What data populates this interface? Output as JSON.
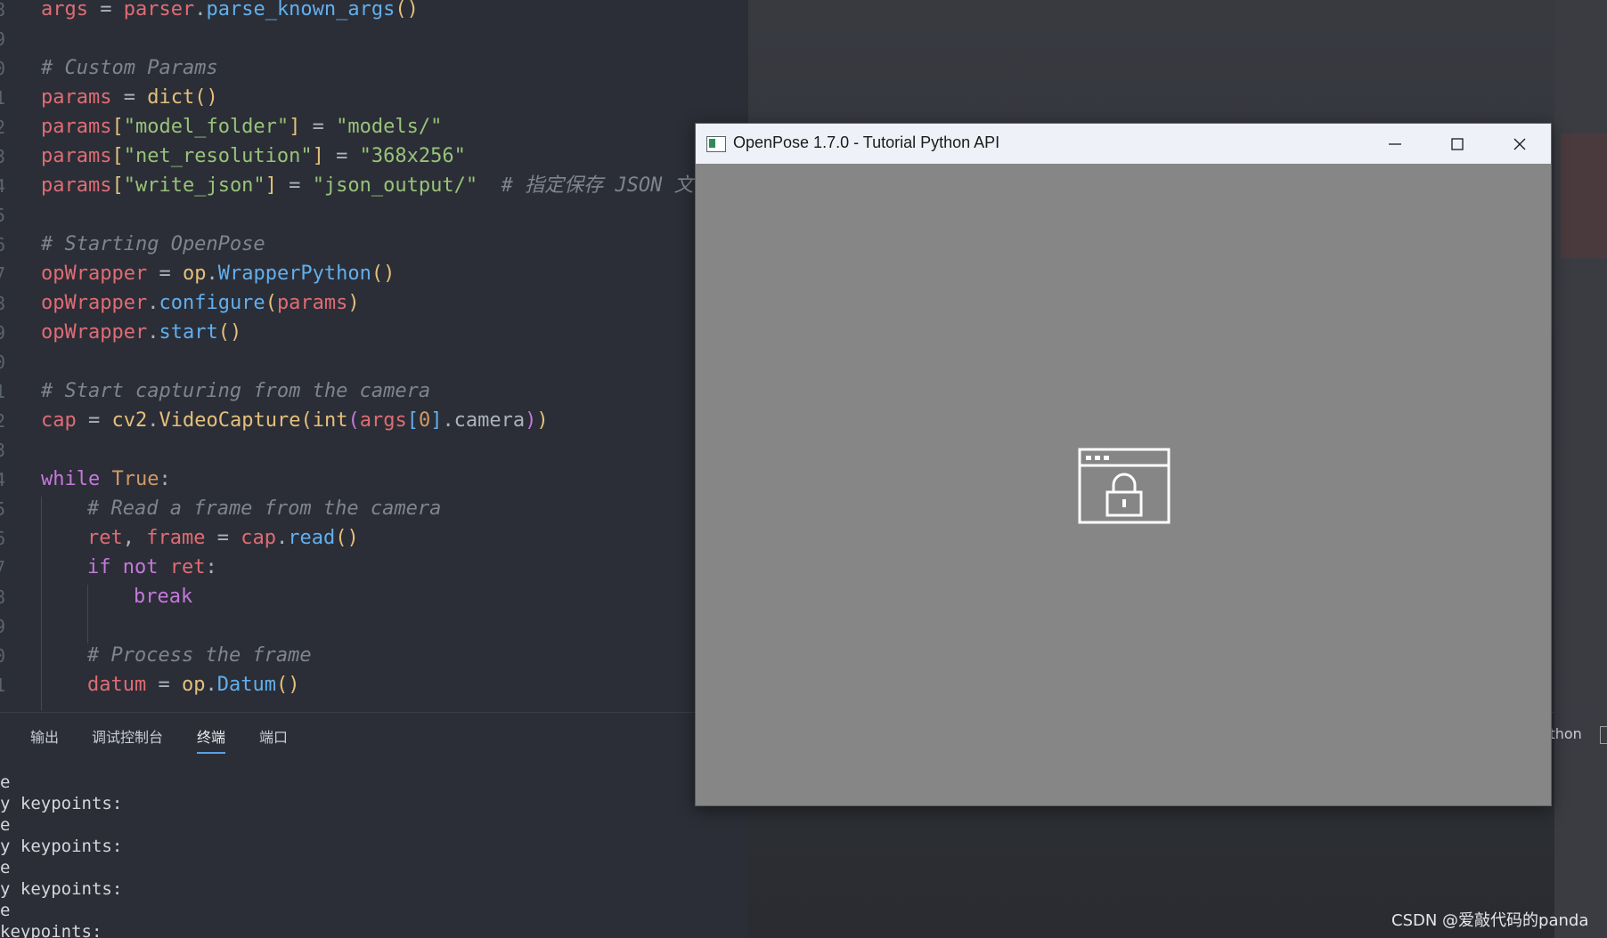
{
  "editor": {
    "lines": [
      {
        "n": "8",
        "parts": [
          [
            "var",
            "args"
          ],
          [
            "pun",
            " = "
          ],
          [
            "var",
            "parser"
          ],
          [
            "pun",
            "."
          ],
          [
            "fn",
            "parse_known_args"
          ],
          [
            "br1",
            "()"
          ]
        ]
      },
      {
        "n": "9",
        "parts": []
      },
      {
        "n": "0",
        "parts": [
          [
            "cmt",
            "# Custom Params"
          ]
        ]
      },
      {
        "n": "1",
        "parts": [
          [
            "var",
            "params"
          ],
          [
            "pun",
            " = "
          ],
          [
            "cls",
            "dict"
          ],
          [
            "br1",
            "()"
          ]
        ]
      },
      {
        "n": "2",
        "parts": [
          [
            "var",
            "params"
          ],
          [
            "br1",
            "["
          ],
          [
            "str",
            "\"model_folder\""
          ],
          [
            "br1",
            "]"
          ],
          [
            "pun",
            " = "
          ],
          [
            "str",
            "\"models/\""
          ]
        ]
      },
      {
        "n": "3",
        "parts": [
          [
            "var",
            "params"
          ],
          [
            "br1",
            "["
          ],
          [
            "str",
            "\"net_resolution\""
          ],
          [
            "br1",
            "]"
          ],
          [
            "pun",
            " = "
          ],
          [
            "str",
            "\"368x256\""
          ]
        ]
      },
      {
        "n": "4",
        "parts": [
          [
            "var",
            "params"
          ],
          [
            "br1",
            "["
          ],
          [
            "str",
            "\"write_json\""
          ],
          [
            "br1",
            "]"
          ],
          [
            "pun",
            " = "
          ],
          [
            "str",
            "\"json_output/\""
          ],
          [
            "pun",
            "  "
          ],
          [
            "cmt",
            "# 指定保存 JSON 文"
          ]
        ]
      },
      {
        "n": "5",
        "parts": []
      },
      {
        "n": "6",
        "parts": [
          [
            "cmt",
            "# Starting OpenPose"
          ]
        ]
      },
      {
        "n": "7",
        "parts": [
          [
            "var",
            "opWrapper"
          ],
          [
            "pun",
            " = "
          ],
          [
            "cls",
            "op"
          ],
          [
            "pun",
            "."
          ],
          [
            "fn",
            "WrapperPython"
          ],
          [
            "br1",
            "()"
          ]
        ]
      },
      {
        "n": "8",
        "parts": [
          [
            "var",
            "opWrapper"
          ],
          [
            "pun",
            "."
          ],
          [
            "fn",
            "configure"
          ],
          [
            "br1",
            "("
          ],
          [
            "var",
            "params"
          ],
          [
            "br1",
            ")"
          ]
        ]
      },
      {
        "n": "9",
        "parts": [
          [
            "var",
            "opWrapper"
          ],
          [
            "pun",
            "."
          ],
          [
            "fn",
            "start"
          ],
          [
            "br1",
            "()"
          ]
        ]
      },
      {
        "n": "0",
        "parts": []
      },
      {
        "n": "1",
        "parts": [
          [
            "cmt",
            "# Start capturing from the camera"
          ]
        ]
      },
      {
        "n": "2",
        "parts": [
          [
            "var",
            "cap"
          ],
          [
            "pun",
            " = "
          ],
          [
            "cls",
            "cv2"
          ],
          [
            "pun",
            "."
          ],
          [
            "cls",
            "VideoCapture"
          ],
          [
            "br1",
            "("
          ],
          [
            "cls",
            "int"
          ],
          [
            "br2",
            "("
          ],
          [
            "var",
            "args"
          ],
          [
            "br3",
            "["
          ],
          [
            "num",
            "0"
          ],
          [
            "br3",
            "]"
          ],
          [
            "pun",
            ".camera"
          ],
          [
            "br2",
            ")"
          ],
          [
            "br1",
            ")"
          ]
        ]
      },
      {
        "n": "3",
        "parts": []
      },
      {
        "n": "4",
        "parts": [
          [
            "kw",
            "while"
          ],
          [
            "pun",
            " "
          ],
          [
            "num",
            "True"
          ],
          [
            "pun",
            ":"
          ]
        ]
      },
      {
        "n": "5",
        "indent": 1,
        "parts": [
          [
            "cmt",
            "# Read a frame from the camera"
          ]
        ]
      },
      {
        "n": "6",
        "indent": 1,
        "parts": [
          [
            "var",
            "ret"
          ],
          [
            "pun",
            ", "
          ],
          [
            "var",
            "frame"
          ],
          [
            "pun",
            " = "
          ],
          [
            "var",
            "cap"
          ],
          [
            "pun",
            "."
          ],
          [
            "fn",
            "read"
          ],
          [
            "br1",
            "()"
          ]
        ]
      },
      {
        "n": "7",
        "indent": 1,
        "parts": [
          [
            "kw",
            "if"
          ],
          [
            "pun",
            " "
          ],
          [
            "kw",
            "not"
          ],
          [
            "pun",
            " "
          ],
          [
            "var",
            "ret"
          ],
          [
            "pun",
            ":"
          ]
        ]
      },
      {
        "n": "8",
        "indent": 2,
        "parts": [
          [
            "kw",
            "break"
          ]
        ]
      },
      {
        "n": "9",
        "parts": []
      },
      {
        "n": "0",
        "indent": 1,
        "parts": [
          [
            "cmt",
            "# Process the frame"
          ]
        ]
      },
      {
        "n": "1",
        "indent": 1,
        "parts": [
          [
            "var",
            "datum"
          ],
          [
            "pun",
            " = "
          ],
          [
            "cls",
            "op"
          ],
          [
            "pun",
            "."
          ],
          [
            "fn",
            "Datum"
          ],
          [
            "br1",
            "()"
          ]
        ]
      }
    ]
  },
  "panel": {
    "tabs": [
      "输出",
      "调试控制台",
      "终端",
      "端口"
    ],
    "active_tab": "终端",
    "right_label": "ython",
    "terminal_lines": [
      "e",
      "y keypoints:",
      "e",
      "y keypoints:",
      "e",
      "y keypoints:",
      "e",
      "keypoints:"
    ]
  },
  "window": {
    "title": "OpenPose 1.7.0 - Tutorial Python API",
    "minimize_icon": "minimize-icon",
    "maximize_icon": "maximize-icon",
    "close_icon": "close-icon",
    "content_icon": "locked-window-icon",
    "content_bg": "#868686"
  },
  "watermark": "CSDN @爱敲代码的panda"
}
